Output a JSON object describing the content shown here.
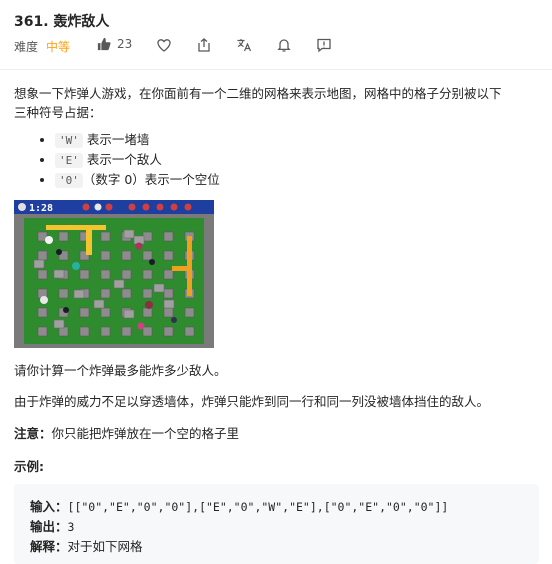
{
  "header": {
    "title": "361. 轰炸敌人",
    "difficulty_label": "难度",
    "difficulty_value": "中等",
    "likes": "23"
  },
  "icons": [
    "thumbs-up-icon",
    "heart-icon",
    "share-icon",
    "translate-icon",
    "bell-icon",
    "feedback-icon"
  ],
  "colors": {
    "difficulty": "#ffa116",
    "code_bg": "#f2f2f2",
    "example_bg": "#f7f8fa"
  },
  "description": {
    "intro_line1": "想象一下炸弹人游戏，在你面前有一个二维的网格来表示地图，网格中的格子分别被以下",
    "intro_line2": "三种符号占据：",
    "items": [
      {
        "code": "'W'",
        "text": " 表示一堵墙"
      },
      {
        "code": "'E'",
        "text": " 表示一个敌人"
      },
      {
        "code": "'0'",
        "text": "（数字 0）表示一个空位"
      }
    ],
    "game_timer": "1:28",
    "question": "请你计算一个炸弹最多能炸多少敌人。",
    "rule": "由于炸弹的威力不足以穿透墙体，炸弹只能炸到同一行和同一列没被墙体挡住的敌人。",
    "note_label": "注意：",
    "note_text": "你只能把炸弹放在一个空的格子里",
    "example_heading": "示例:"
  },
  "example": {
    "input_label": "输入：",
    "input_value": "[[\"0\",\"E\",\"0\",\"0\"],[\"E\",\"0\",\"W\",\"E\"],[\"0\",\"E\",\"0\",\"0\"]]",
    "output_label": "输出：",
    "output_value": "3",
    "explain_label": "解释：",
    "explain_value": "对于如下网格"
  }
}
